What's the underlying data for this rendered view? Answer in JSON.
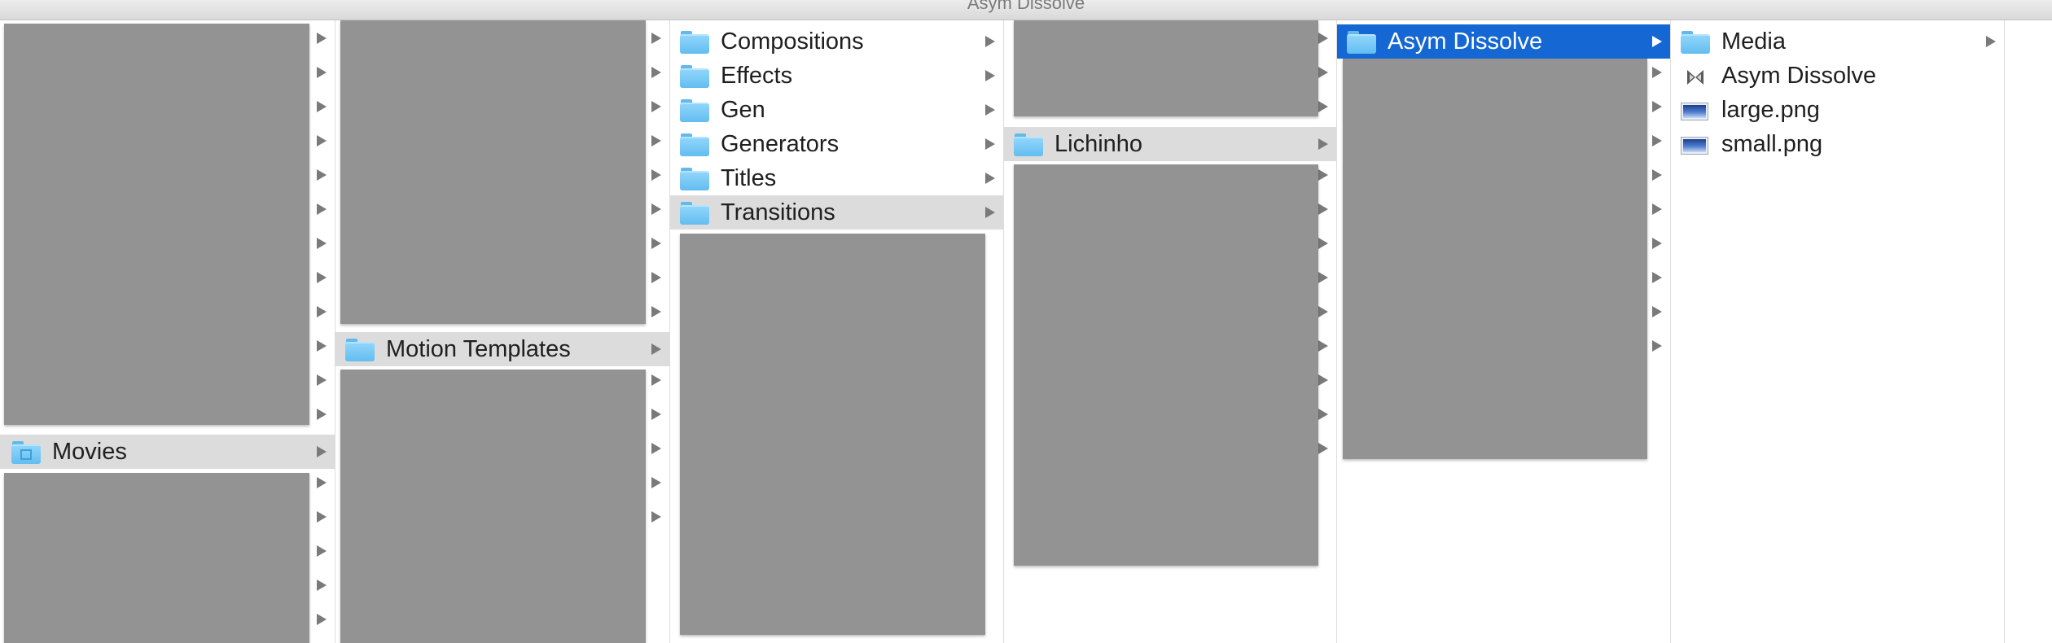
{
  "window": {
    "title": "Asym Dissolve"
  },
  "columns": {
    "col1": {
      "movies": "Movies"
    },
    "col2": {
      "motion_templates": "Motion Templates"
    },
    "col3": {
      "items": [
        "Compositions",
        "Effects",
        "Gen",
        "Generators",
        "Titles",
        "Transitions"
      ]
    },
    "col4": {
      "lichinho": "Lichinho"
    },
    "col5": {
      "asym_dissolve": "Asym Dissolve"
    },
    "col6": {
      "items": [
        "Media",
        "Asym Dissolve",
        "large.png",
        "small.png"
      ]
    }
  },
  "colors": {
    "selection": "#1567d3",
    "highlight": "#dcdcdc",
    "folder": "#62bdf0",
    "redaction": "#939393"
  },
  "icons": {
    "folder": "folder-icon",
    "movies_folder": "movies-folder-icon",
    "transition_file": "bowtie-icon",
    "image_file": "png-file-icon",
    "disclosure": "chevron-right-icon"
  }
}
